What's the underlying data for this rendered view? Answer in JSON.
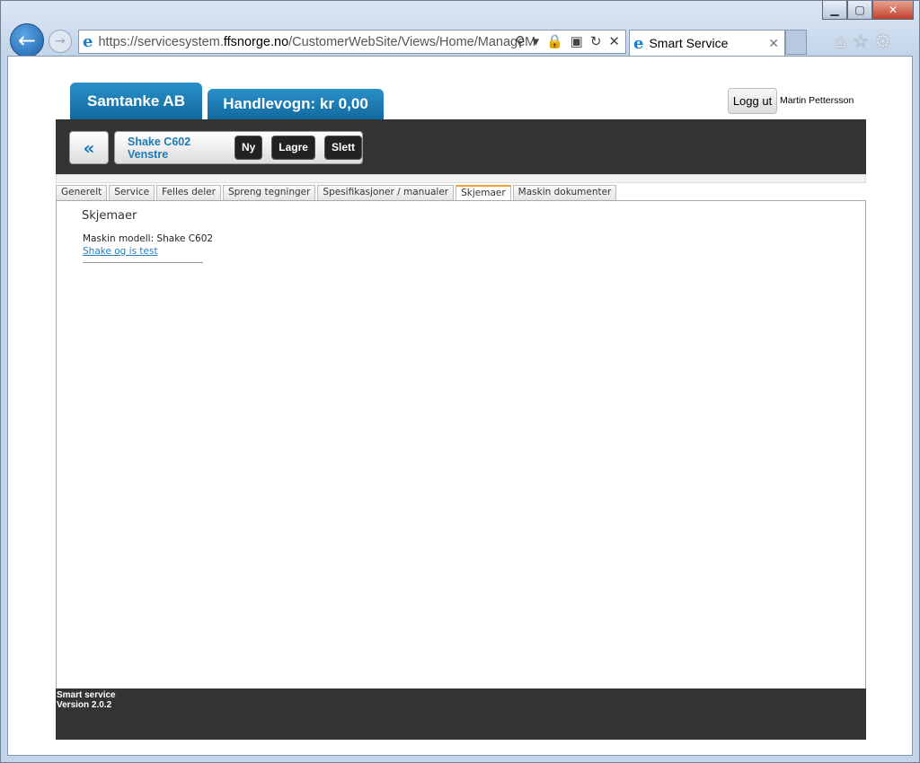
{
  "browser": {
    "url_prefix": "https://servicesystem.",
    "url_host": "ffsnorge.no",
    "url_path": "/CustomerWebSite/Views/Home/ManageM",
    "tab_title": "Smart Service"
  },
  "header": {
    "company_tab": "Samtanke AB",
    "cart_tab": "Handlevogn: kr 0,00",
    "logout": "Logg ut",
    "user": "Martin Pettersson"
  },
  "toolbar": {
    "back": "«",
    "title": "Shake C602 Venstre",
    "new": "Ny",
    "save": "Lagre",
    "delete": "Slett"
  },
  "tabs": [
    {
      "label": "Generelt"
    },
    {
      "label": "Service"
    },
    {
      "label": "Felles deler"
    },
    {
      "label": "Spreng tegninger"
    },
    {
      "label": "Spesifikasjoner / manualer"
    },
    {
      "label": "Skjemaer",
      "active": true
    },
    {
      "label": "Maskin dokumenter"
    }
  ],
  "panel": {
    "title": "Skjemaer",
    "model": "Maskin modell: Shake C602",
    "link": "Shake og is test"
  },
  "footer": {
    "line1": "Smart service",
    "line2": "Version 2.0.2"
  }
}
